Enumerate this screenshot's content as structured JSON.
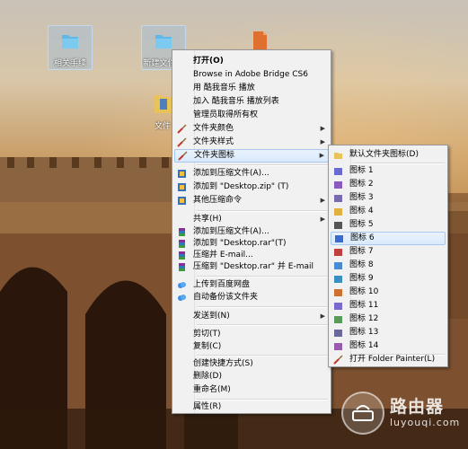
{
  "desktop": {
    "icons": [
      {
        "label": "相关手续",
        "icon": "folder-icon"
      },
      {
        "label": "新建文件夹",
        "icon": "folder-icon"
      },
      {
        "label": "",
        "icon": "document-icon"
      },
      {
        "label": "文件",
        "icon": "folder-icon"
      }
    ]
  },
  "context_menu": {
    "items": {
      "open": "打开(O)",
      "bridge": "Browse in Adobe Bridge CS6",
      "play_kugou": "用 酷我音乐 播放",
      "add_playlist": "加入 酷我音乐 播放列表",
      "admin_owner": "管理员取得所有权",
      "folder_color": "文件夹颜色",
      "folder_style": "文件夹样式",
      "folder_icon": "文件夹图标",
      "add_archive": "添加到压缩文件(A)...",
      "add_desktop_zip": "添加到 \"Desktop.zip\" (T)",
      "other_compress": "其他压缩命令",
      "share": "共享(H)",
      "add_archive2": "添加到压缩文件(A)...",
      "add_desktop_rar": "添加到 \"Desktop.rar\"(T)",
      "compress_email": "压缩并 E-mail...",
      "compress_rar_email": "压缩到 \"Desktop.rar\" 并 E-mail",
      "upload_baidu": "上传到百度网盘",
      "auto_backup": "自动备份该文件夹",
      "send_to": "发送到(N)",
      "cut": "剪切(T)",
      "copy": "复制(C)",
      "create_shortcut": "创建快捷方式(S)",
      "delete": "删除(D)",
      "rename": "重命名(M)",
      "properties": "属性(R)"
    }
  },
  "submenu": {
    "items": [
      "默认文件夹图标(D)",
      "图标 1",
      "图标 2",
      "图标 3",
      "图标 4",
      "图标 5",
      "图标 6",
      "图标 7",
      "图标 8",
      "图标 9",
      "图标 10",
      "图标 11",
      "图标 12",
      "图标 13",
      "图标 14",
      "打开 Folder Painter(L)"
    ],
    "highlighted": "图标 6"
  },
  "watermark": {
    "title": "路由器",
    "subtitle": "luyouqi.com"
  },
  "colors": {
    "menu_bg": "#f1f1f1",
    "highlight": "#d9e9fb",
    "highlight_border": "#a8c8ee",
    "folder_blue": "#5fb8e6"
  }
}
